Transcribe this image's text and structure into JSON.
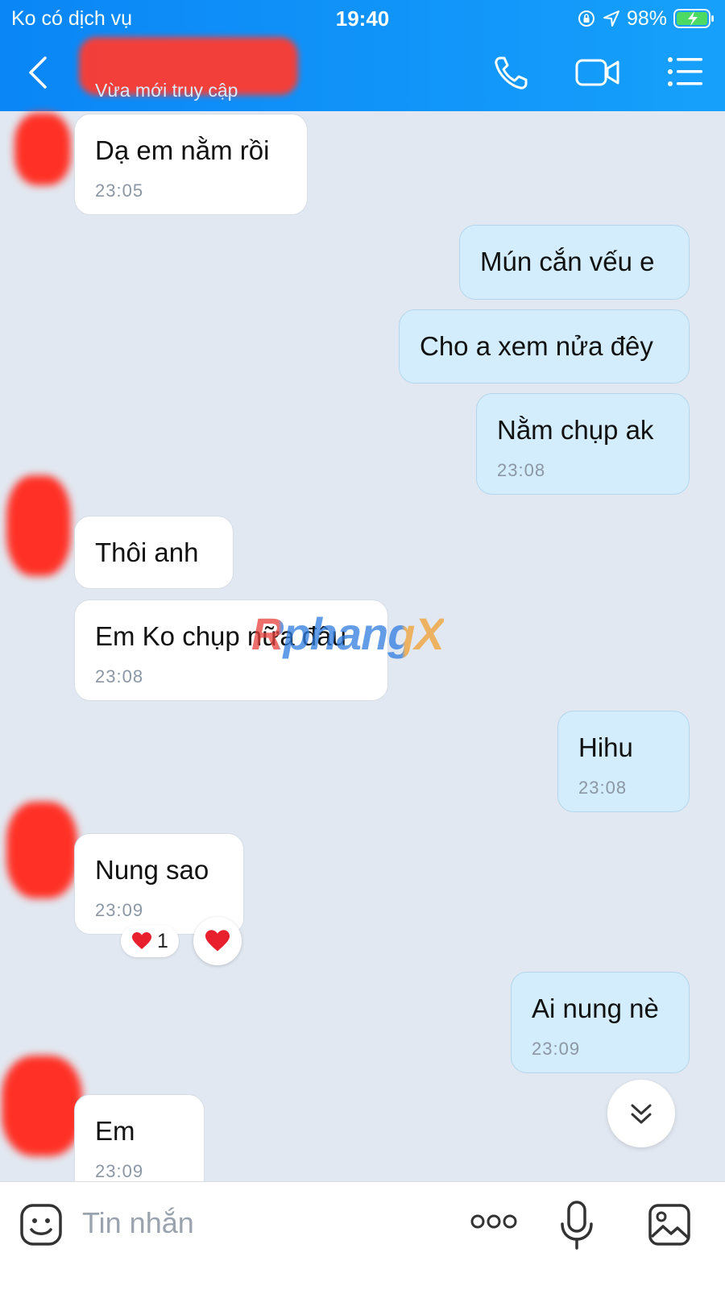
{
  "status_bar": {
    "carrier": "Ko có dịch vụ",
    "time": "19:40",
    "battery": "98%"
  },
  "header": {
    "subtitle": "Vừa mới truy cập",
    "accent_color": "#0a86f6",
    "icons": [
      "back-icon",
      "phone-icon",
      "video-camera-icon",
      "menu-list-icon"
    ]
  },
  "messages": [
    {
      "side": "in",
      "text": "Dạ em nằm rồi",
      "time": "23:05"
    },
    {
      "side": "out",
      "text": "Mún cắn vếu e",
      "time": ""
    },
    {
      "side": "out",
      "text": "Cho a xem nửa đêy",
      "time": ""
    },
    {
      "side": "out",
      "text": "Nằm chụp ak",
      "time": "23:08"
    },
    {
      "side": "in",
      "text": "Thôi anh",
      "time": ""
    },
    {
      "side": "in",
      "text": "Em Ko chụp nữa đâu",
      "time": "23:08"
    },
    {
      "side": "out",
      "text": "Hihu",
      "time": "23:08"
    },
    {
      "side": "in",
      "text": "Nung sao",
      "time": "23:09"
    },
    {
      "side": "out",
      "text": "Ai nung nè",
      "time": "23:09"
    },
    {
      "side": "in",
      "text": "Em",
      "time": "23:09"
    }
  ],
  "reaction": {
    "count": "1",
    "icon": "heart-icon"
  },
  "watermark": "RphangX",
  "composer": {
    "placeholder": "Tin nhắn",
    "icons": [
      "sticker-icon",
      "more-icon",
      "microphone-icon",
      "image-icon"
    ]
  }
}
